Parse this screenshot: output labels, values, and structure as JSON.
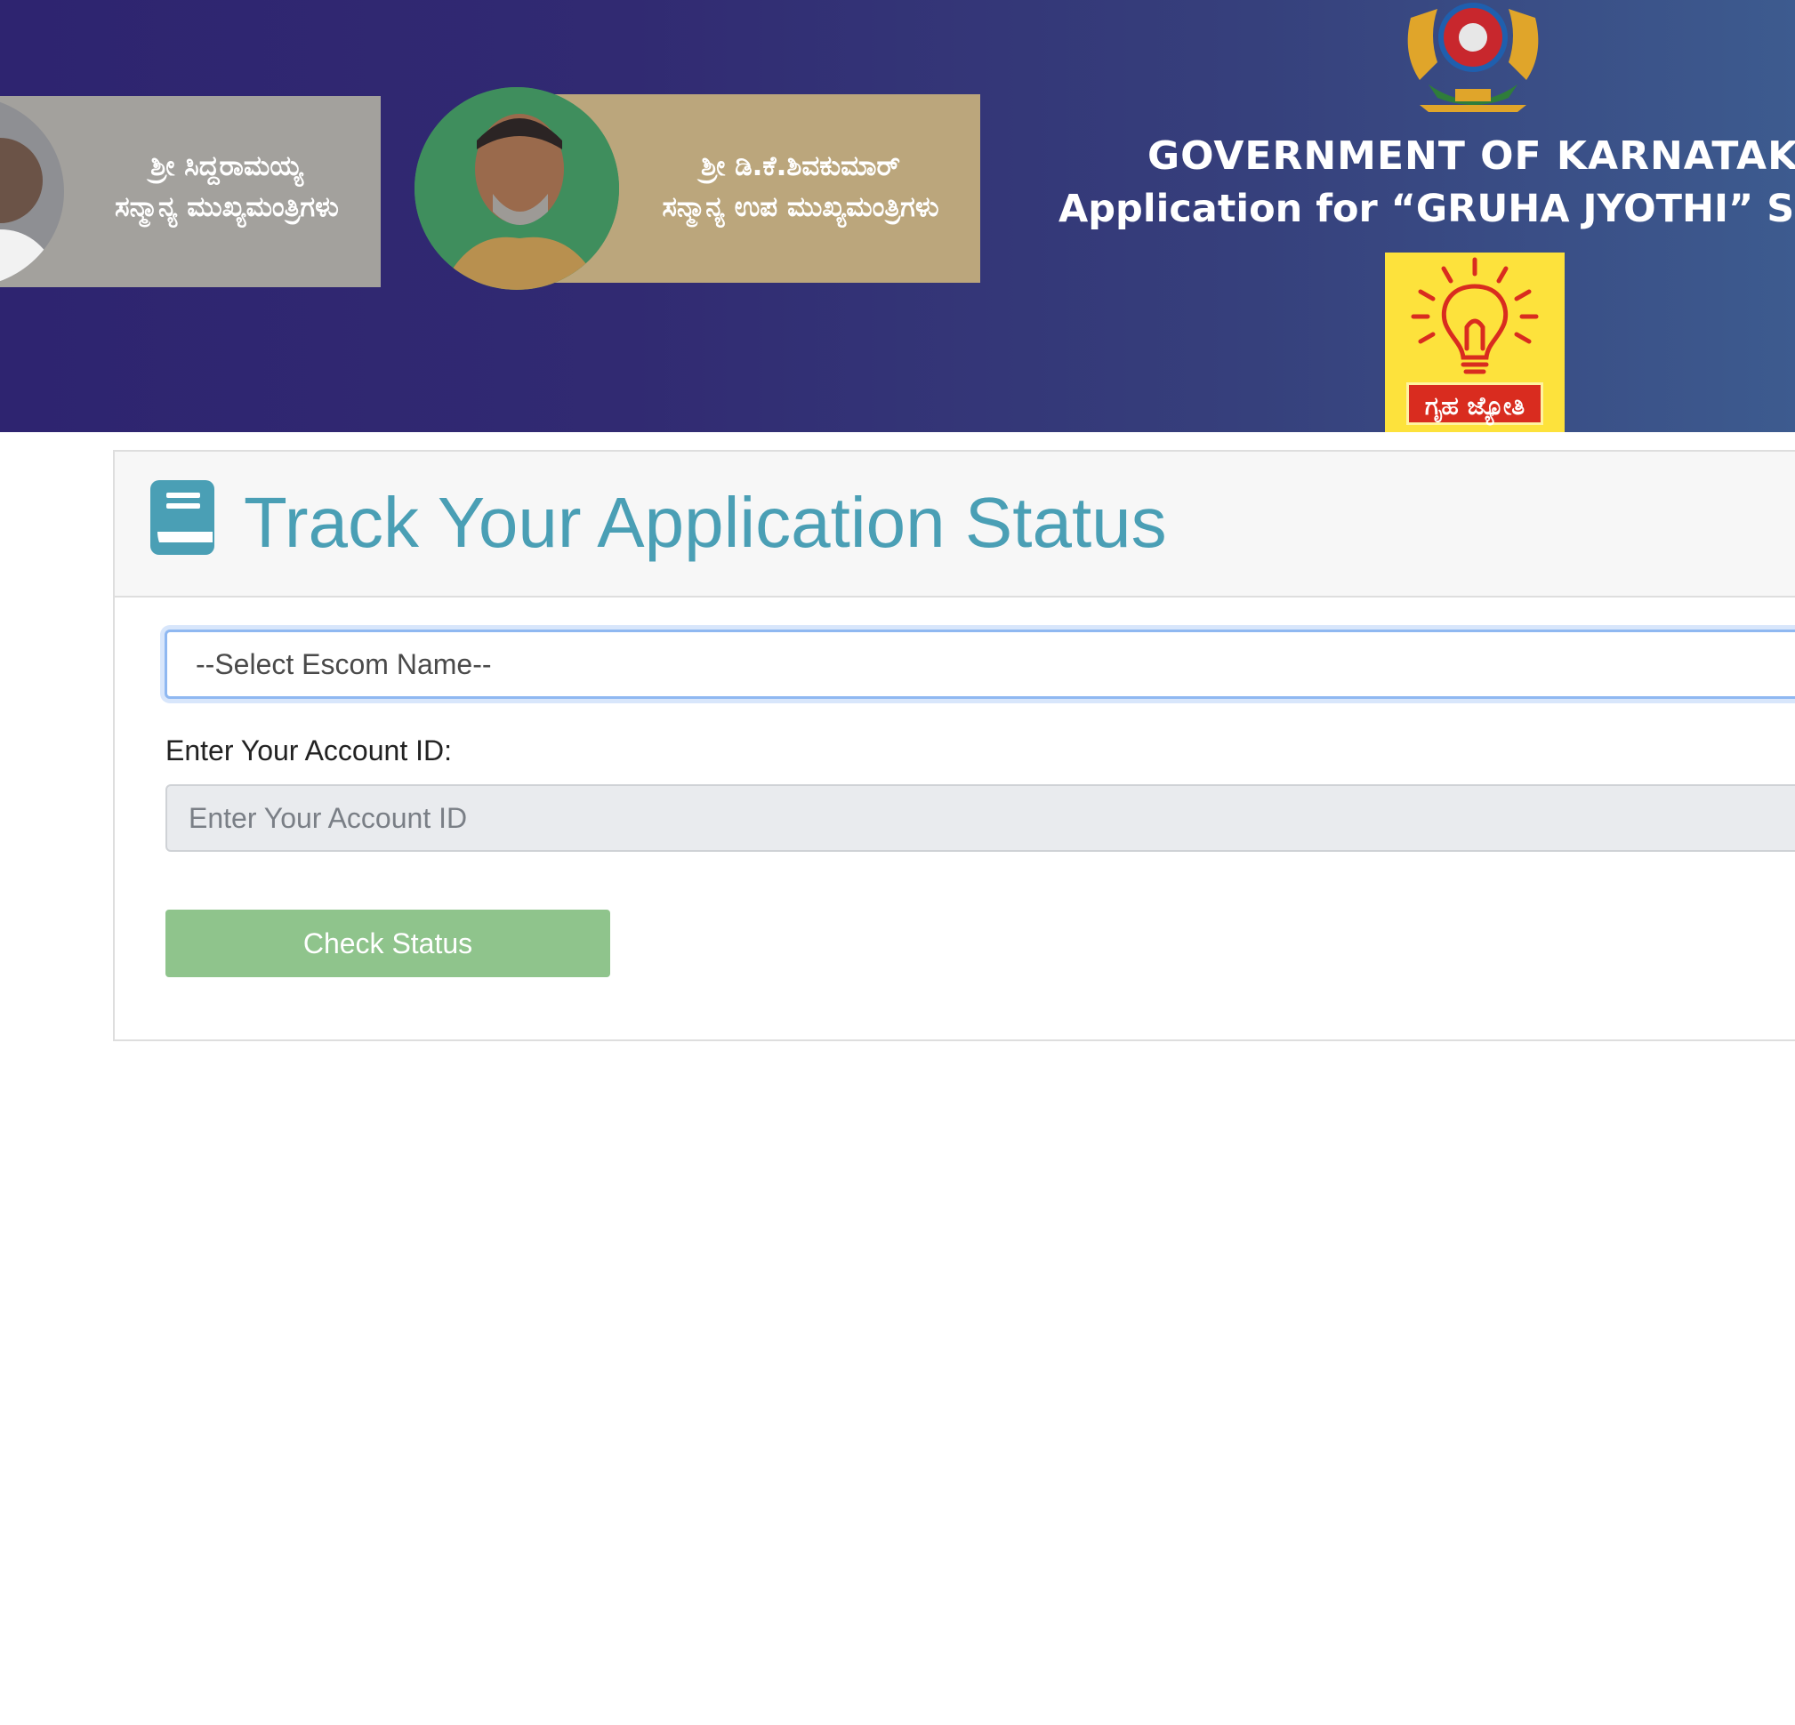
{
  "banner": {
    "leader1": {
      "name": "ಶ್ರೀ ಸಿದ್ದರಾಮಯ್ಯ",
      "title": "ಸನ್ಮಾನ್ಯ ಮುಖ್ಯಮಂತ್ರಿಗಳು"
    },
    "leader2": {
      "name": "ಶ್ರೀ ಡಿ.ಕೆ.ಶಿವಕುಮಾರ್",
      "title": "ಸನ್ಮಾನ್ಯ ಉಪ ಮುಖ್ಯಮಂತ್ರಿಗಳು"
    },
    "gov_title": "GOVERNMENT OF KARNATAKA",
    "scheme_title": "Application for “GRUHA JYOTHI” Scher",
    "scheme_logo_label": "ಗೃಹ ಜ್ಯೋತಿ"
  },
  "card": {
    "title": "Track Your Application Status",
    "title_color": "#4a9fb5"
  },
  "form": {
    "escom_select_value": "--Select Escom Name--",
    "account_label": "Enter Your Account ID:",
    "account_placeholder": "Enter Your Account ID",
    "account_value": "",
    "check_button_label": "Check Status",
    "button_color": "#8fc48c"
  }
}
